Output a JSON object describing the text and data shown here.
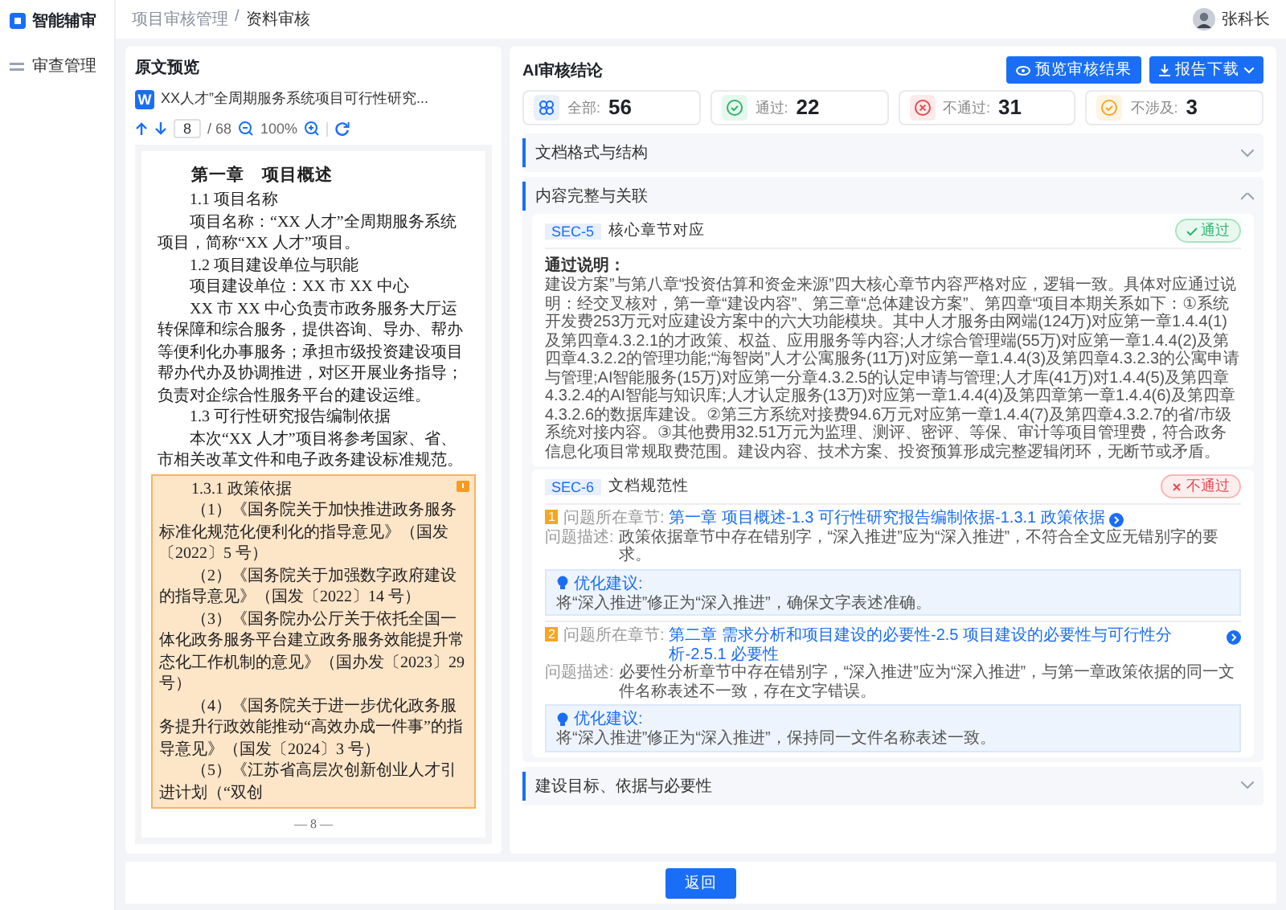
{
  "app": {
    "name": "智能辅审"
  },
  "sidebar": {
    "items": [
      {
        "label": "审查管理"
      }
    ]
  },
  "breadcrumb": {
    "items": [
      "项目审核管理",
      "资料审核"
    ],
    "separator": "/"
  },
  "user": {
    "name": "张科长"
  },
  "preview": {
    "title": "原文预览",
    "file_badge": "W",
    "file_name": "XX人才”全周期服务系统项目可行性研究...",
    "page_input": "8",
    "page_total": "/ 68",
    "zoom": "100%",
    "blocks": [
      {
        "kind": "heading",
        "text": "第一章　项目概述"
      },
      {
        "kind": "sub",
        "text": "1.1 项目名称"
      },
      {
        "kind": "para",
        "text": "项目名称：“XX 人才”全周期服务系统项目，简称“XX 人才”项目。"
      },
      {
        "kind": "sub",
        "text": "1.2 项目建设单位与职能"
      },
      {
        "kind": "para",
        "text": "项目建设单位：XX 市 XX 中心"
      },
      {
        "kind": "para",
        "text": "XX 市 XX 中心负责市政务服务大厅运转保障和综合服务，提供咨询、导办、帮办等便利化办事服务；承担市级投资建设项目帮办代办及协调推进，对区开展业务指导；负责对企综合性服务平台的建设运维。"
      },
      {
        "kind": "sub",
        "text": "1.3 可行性研究报告编制依据"
      },
      {
        "kind": "para",
        "text": "本次“XX 人才”项目将参考国家、省、市相关改革文件和电子政务建设标准规范。"
      }
    ],
    "highlight": {
      "blocks": [
        {
          "kind": "sub",
          "text": "1.3.1 政策依据"
        },
        {
          "kind": "para",
          "text": "（1）《国务院关于加快推进政务服务标准化规范化便利化的指导意见》（国发〔2022〕5 号）"
        },
        {
          "kind": "para",
          "text": "（2）《国务院关于加强数字政府建设的指导意见》（国发〔2022〕14 号）"
        },
        {
          "kind": "para",
          "text": "（3）《国务院办公厅关于依托全国一体化政务服务平台建立政务服务效能提升常态化工作机制的意见》（国办发〔2023〕29 号）"
        },
        {
          "kind": "para",
          "text": "（4）《国务院关于进一步优化政务服务提升行政效能推动“高效办成一件事”的指导意见》（国发〔2024〕3 号）"
        },
        {
          "kind": "para",
          "text": "（5）《江苏省高层次创新创业人才引进计划（“双创"
        }
      ]
    },
    "page_number": "— 8 —"
  },
  "review": {
    "title": "AI审核结论",
    "buttons": [
      {
        "kind": "preview",
        "label": "预览审核结果"
      },
      {
        "kind": "download",
        "label": "报告下载"
      }
    ],
    "stats": [
      {
        "kind": "all",
        "label": "全部:",
        "value": "56"
      },
      {
        "kind": "pass",
        "label": "通过:",
        "value": "22"
      },
      {
        "kind": "fail",
        "label": "不通过:",
        "value": "31"
      },
      {
        "kind": "na",
        "label": "不涉及:",
        "value": "3"
      }
    ],
    "sections": [
      {
        "title": "文档格式与结构",
        "expanded": false
      },
      {
        "title": "内容完整与关联",
        "expanded": true,
        "cards": [
          {
            "code": "SEC-5",
            "title": "核心章节对应",
            "kind": "pass",
            "status_label": "通过",
            "explanation_label": "通过说明：",
            "explanation": "建设方案”与第八章“投资估算和资金来源”四大核心章节内容严格对应，逻辑一致。具体对应通过说明：经交叉核对，第一章“建设内容”、第三章“总体建设方案”、第四章“项目本期关系如下：①系统开发费253万元对应建设方案中的六大功能模块。其中人才服务由网端(124万)对应第一章1.4.4(1)及第四章4.3.2.1的才政策、权益、应用服务等内容;人才综合管理端(55万)对应第一章1.4.4(2)及第四章4.3.2.2的管理功能;“海智岗”人才公寓服务(11万)对应第一章1.4.4(3)及第四章4.3.2.3的公寓申请与管理;AI智能服务(15万)对应第一分章4.3.2.5的认定申请与管理;人才库(41万)对1.4.4(5)及第四章4.3.2.4的AI智能与知识库;人才认定服务(13万)对应第一章1.4.4(4)及第四章第一章1.4.4(6)及第四章4.3.2.6的数据库建设。②第三方系统对接费94.6万元对应第一章1.4.4(7)及第四章4.3.2.7的省/市级系统对接内容。③其他费用32.51万元为监理、测评、密评、等保、审计等项目管理费，符合政务信息化项目常规取费范围。建设内容、技术方案、投资预算形成完整逻辑闭环，无断节或矛盾。"
          },
          {
            "code": "SEC-6",
            "title": "文档规范性",
            "kind": "fail",
            "status_label": "不通过",
            "issues": [
              {
                "number": "1",
                "chapter_label": "问题所在章节:",
                "chapter": "第一章 项目概述-1.3 可行性研究报告编制依据-1.3.1 政策依据",
                "desc_label": "问题描述:",
                "desc": "政策依据章节中存在错别字，“深入推进”应为“深入推进”，不符合全文应无错别字的要求。",
                "suggest_label": "优化建议:",
                "suggest": "将“深入推进”修正为“深入推进”，确保文字表述准确。"
              },
              {
                "number": "2",
                "chapter_label": "问题所在章节:",
                "chapter": "第二章 需求分析和项目建设的必要性-2.5 项目建设的必要性与可行性分析-2.5.1 必要性",
                "desc_label": "问题描述:",
                "desc": "必要性分析章节中存在错别字，“深入推进”应为“深入推进”，与第一章政策依据的同一文件名称表述不一致，存在文字错误。",
                "suggest_label": "优化建议:",
                "suggest": "将“深入推进”修正为“深入推进”，保持同一文件名称表述一致。"
              }
            ]
          }
        ]
      },
      {
        "title": "建设目标、依据与必要性",
        "expanded": false
      }
    ]
  },
  "footer": {
    "back_button": "返回"
  }
}
